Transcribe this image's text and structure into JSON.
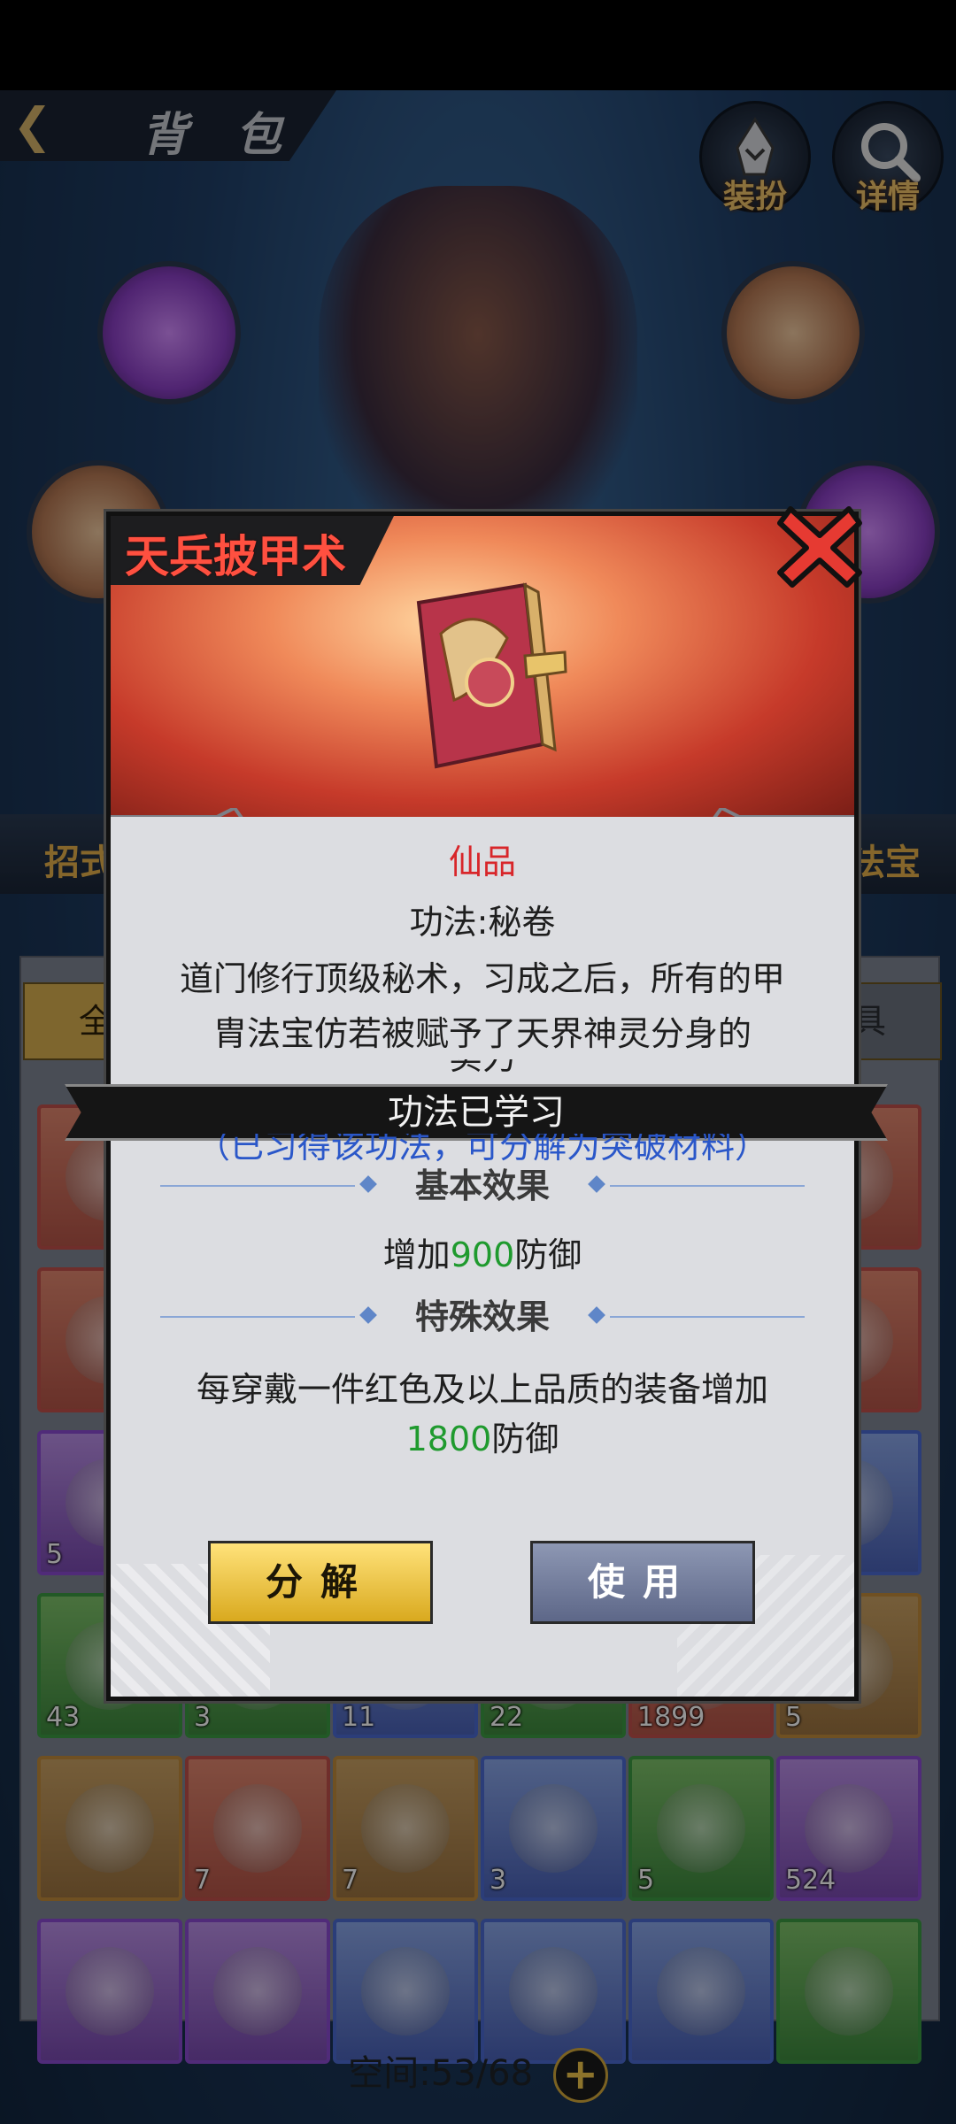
{
  "header": {
    "back_icon": "back-arrow-icon",
    "title": "背 包"
  },
  "top_buttons": [
    {
      "label": "装扮",
      "icon": "hooded-figure-icon"
    },
    {
      "label": "详情",
      "icon": "magnifier-icon"
    }
  ],
  "tabs": {
    "left_partial": "招式",
    "right_partial": "法宝"
  },
  "filters": {
    "left_partial": "全",
    "right_partial": "具"
  },
  "inventory": {
    "capacity_label": "空间:53/68",
    "rows": [
      [
        {
          "count": "",
          "color": "red"
        },
        {
          "count": "",
          "color": "red"
        },
        {
          "count": "",
          "color": "red"
        },
        {
          "count": "",
          "color": "red"
        },
        {
          "count": "",
          "color": "red"
        },
        {
          "count": "",
          "color": "red"
        }
      ],
      [
        {
          "count": "",
          "color": "red"
        },
        {
          "count": "",
          "color": "red"
        },
        {
          "count": "",
          "color": "red"
        },
        {
          "count": "",
          "color": "red"
        },
        {
          "count": "",
          "color": "red"
        },
        {
          "count": "",
          "color": "red"
        }
      ],
      [
        {
          "count": "5",
          "color": "purple"
        },
        {
          "count": "",
          "color": "purple"
        },
        {
          "count": "",
          "color": "blue"
        },
        {
          "count": "",
          "color": "blue"
        },
        {
          "count": "",
          "color": "blue"
        },
        {
          "count": "",
          "color": "blue"
        }
      ],
      [
        {
          "count": "43",
          "color": "green"
        },
        {
          "count": "3",
          "color": "green"
        },
        {
          "count": "11",
          "color": "blue"
        },
        {
          "count": "22",
          "color": "green"
        },
        {
          "count": "1899",
          "color": "red"
        },
        {
          "count": "5",
          "color": "gold"
        }
      ],
      [
        {
          "count": "",
          "color": "gold"
        },
        {
          "count": "7",
          "color": "red"
        },
        {
          "count": "7",
          "color": "gold"
        },
        {
          "count": "3",
          "color": "blue"
        },
        {
          "count": "5",
          "color": "green"
        },
        {
          "count": "524",
          "color": "purple"
        }
      ],
      [
        {
          "count": "",
          "color": "purple"
        },
        {
          "count": "",
          "color": "purple"
        },
        {
          "count": "",
          "color": "blue"
        },
        {
          "count": "",
          "color": "blue"
        },
        {
          "count": "",
          "color": "blue"
        },
        {
          "count": "",
          "color": "green"
        }
      ]
    ]
  },
  "modal": {
    "title": "天兵披甲术",
    "close_icon": "close-x-icon",
    "item_icon": "secret-scroll-book-icon",
    "rarity": "仙品",
    "type_line": "功法:秘卷",
    "description": "道门修行顶级秘术，习成之后，所有的甲胄法宝仿若被赋予了天界神灵分身的",
    "description_tail": "实力",
    "learned_banner": "功法已学习",
    "hint": "（已习得该功法，可分解为突破材料）",
    "basic_effect_title": "基本效果",
    "basic_effect": {
      "prefix": "增加",
      "value": "900",
      "suffix": "防御"
    },
    "special_effect_title": "特殊效果",
    "special_effect": {
      "line1": "每穿戴一件红色及以上品质的装备增加",
      "value": "1800",
      "suffix": "防御"
    },
    "buttons": {
      "decompose": "分解",
      "use": "使用"
    },
    "colors": {
      "rarity": "#d8262a",
      "value": "#1f9a2e",
      "hint": "#2a57c9",
      "title": "#ff5040"
    }
  }
}
